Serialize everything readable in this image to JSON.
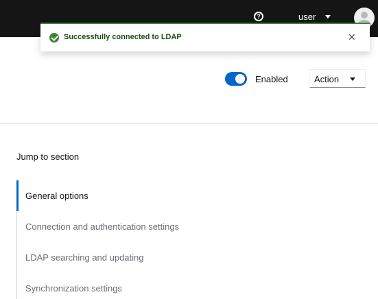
{
  "masthead": {
    "help_icon": "question-circle-icon",
    "user_label": "user",
    "avatar_icon": "avatar-icon"
  },
  "alert": {
    "variant": "success",
    "title": "Successfully connected to LDAP",
    "accent_color": "#3e8635",
    "close_icon": "close-icon"
  },
  "toolbar": {
    "toggle_on": true,
    "toggle_label": "Enabled",
    "action_label": "Action",
    "accent_color": "#0066cc"
  },
  "jump": {
    "title": "Jump to section",
    "items": [
      {
        "label": "General options",
        "active": true
      },
      {
        "label": "Connection and authentication settings",
        "active": false
      },
      {
        "label": "LDAP searching and updating",
        "active": false
      },
      {
        "label": "Synchronization settings",
        "active": false
      }
    ]
  }
}
